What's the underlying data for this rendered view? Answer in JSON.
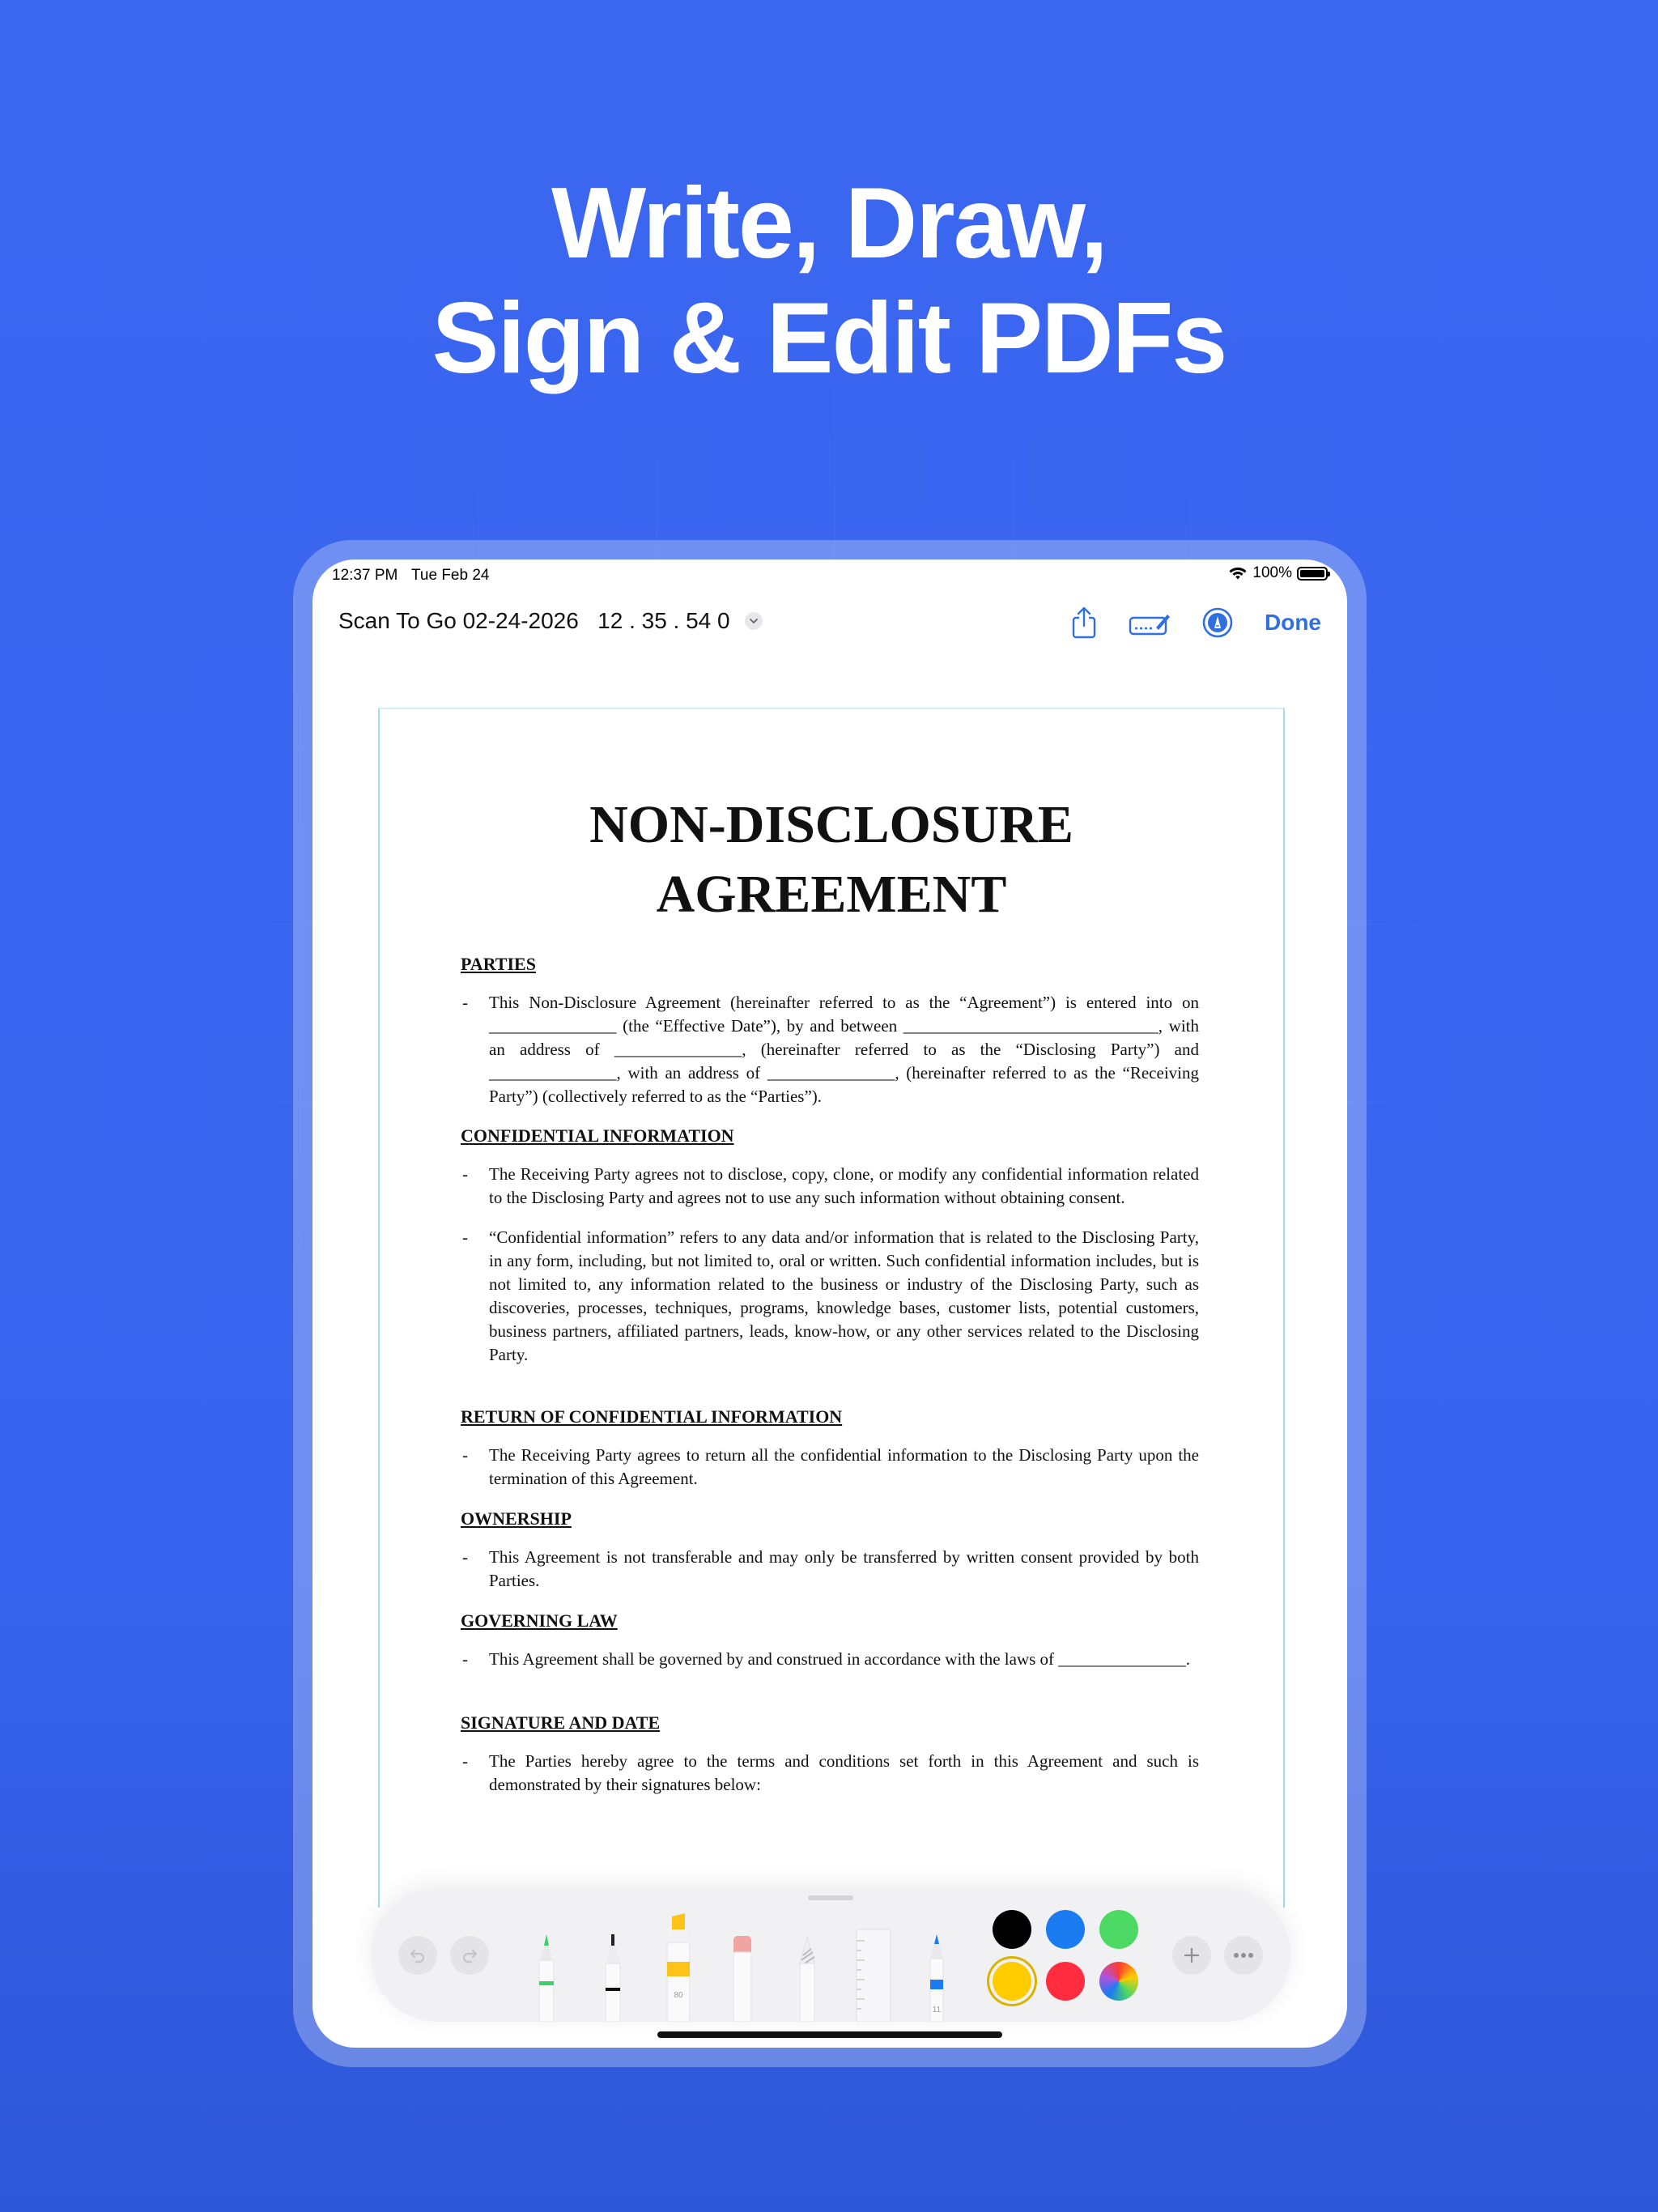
{
  "headline": {
    "line1": "Write, Draw,",
    "line2": "Sign & Edit PDFs"
  },
  "status_bar": {
    "time": "12:37 PM",
    "date": "Tue Feb 24",
    "battery": "100%"
  },
  "nav": {
    "doc_title": "Scan To Go 02-24-2026   12 . 35 . 54 0",
    "share_icon": "share-icon",
    "signature_icon": "signature-icon",
    "markup_icon": "markup-pen-icon",
    "done_label": "Done"
  },
  "document": {
    "title_line1": "NON-DISCLOSURE",
    "title_line2": "AGREEMENT",
    "sections": [
      {
        "heading": "PARTIES",
        "items": [
          "This Non-Disclosure Agreement (hereinafter referred to as the “Agreement”) is entered into on _______________ (the “Effective Date”), by and between ______________________________, with an address of _______________, (hereinafter referred to as the “Disclosing Party”) and _______________, with an address of _______________, (hereinafter referred to as the “Receiving Party”) (collectively referred to as the “Parties”)."
        ]
      },
      {
        "heading": "CONFIDENTIAL INFORMATION",
        "items": [
          "The Receiving Party agrees not to disclose, copy, clone, or modify any confidential information related to the Disclosing Party and agrees not to use any such information without obtaining consent.",
          "“Confidential information” refers to any data and/or information that is related to the Disclosing Party, in any form, including, but not limited to, oral or written. Such confidential information includes, but is not limited to, any information related to the business or industry of the Disclosing Party, such as discoveries, processes, techniques, programs, knowledge bases, customer lists, potential customers, business partners, affiliated partners, leads, know-how, or any other services related to the Disclosing Party."
        ]
      },
      {
        "heading": "RETURN OF CONFIDENTIAL INFORMATION",
        "items": [
          "The Receiving Party agrees to return all the confidential information to the Disclosing Party upon the termination of this Agreement."
        ]
      },
      {
        "heading": "OWNERSHIP",
        "items": [
          "This Agreement is not transferable and may only be transferred by written consent provided by both Parties."
        ]
      },
      {
        "heading": "GOVERNING LAW",
        "items": [
          "This Agreement shall be governed by and construed in accordance with the laws of _______________."
        ]
      },
      {
        "heading": "SIGNATURE AND DATE",
        "items": [
          "The Parties hereby agree to the terms and conditions set forth in this Agreement and such is demonstrated by their signatures below:"
        ]
      }
    ]
  },
  "toolbar": {
    "undo_icon": "undo-icon",
    "redo_icon": "redo-icon",
    "tools": [
      "pen-tool",
      "monoline-tool",
      "highlighter-tool",
      "eraser-tool",
      "lasso-tool",
      "ruler-tool",
      "pencil-tool"
    ],
    "highlighter_label": "80",
    "pencil_label": "11",
    "colors": {
      "black": "#000000",
      "blue": "#1a7cf0",
      "green": "#4cd964",
      "yellow": "#ffcc00",
      "red": "#ff2d3f"
    },
    "selected_color": "yellow",
    "add_icon": "plus-icon",
    "more_icon": "ellipsis-icon"
  }
}
